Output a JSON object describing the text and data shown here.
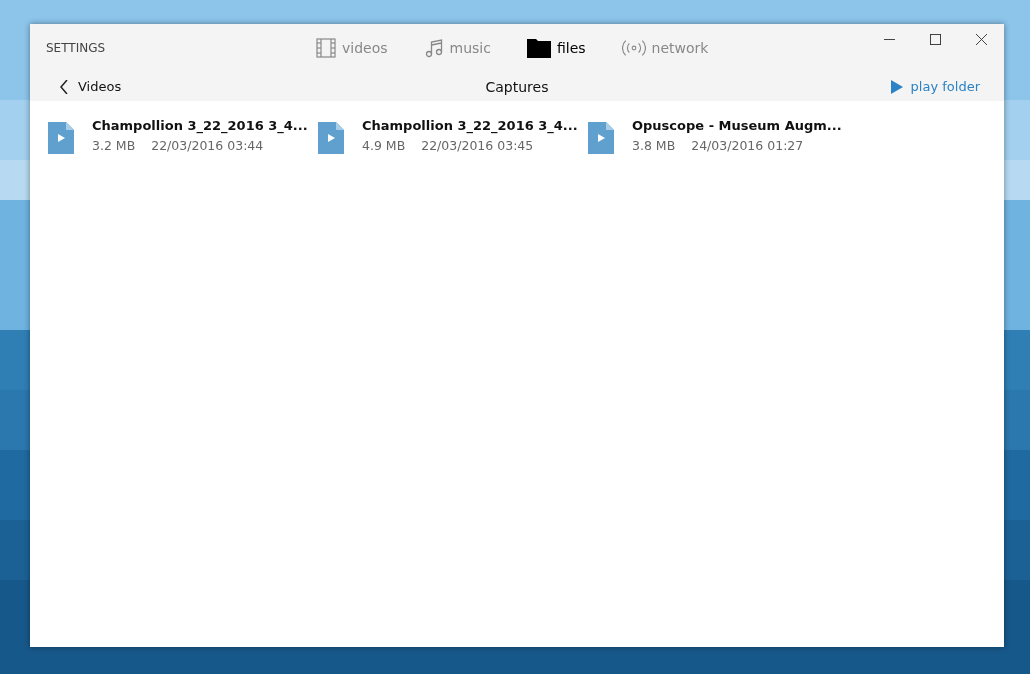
{
  "window": {
    "title": "SETTINGS"
  },
  "tabs": [
    {
      "label": "videos",
      "kind": "film",
      "selected": false
    },
    {
      "label": "music",
      "kind": "note",
      "selected": false
    },
    {
      "label": "files",
      "kind": "folder",
      "selected": true
    },
    {
      "label": "network",
      "kind": "signal",
      "selected": false
    }
  ],
  "nav": {
    "back": "Videos",
    "folder": "Captures",
    "action": "play folder"
  },
  "files": [
    {
      "name": "Champollion 3_22_2016 3_4...",
      "size": "3.2 MB",
      "date": "22/03/2016 03:44"
    },
    {
      "name": "Champollion 3_22_2016 3_4...",
      "size": "4.9 MB",
      "date": "22/03/2016 03:45"
    },
    {
      "name": "Opuscope - Museum Augm...",
      "size": "3.8 MB",
      "date": "24/03/2016 01:27"
    }
  ]
}
